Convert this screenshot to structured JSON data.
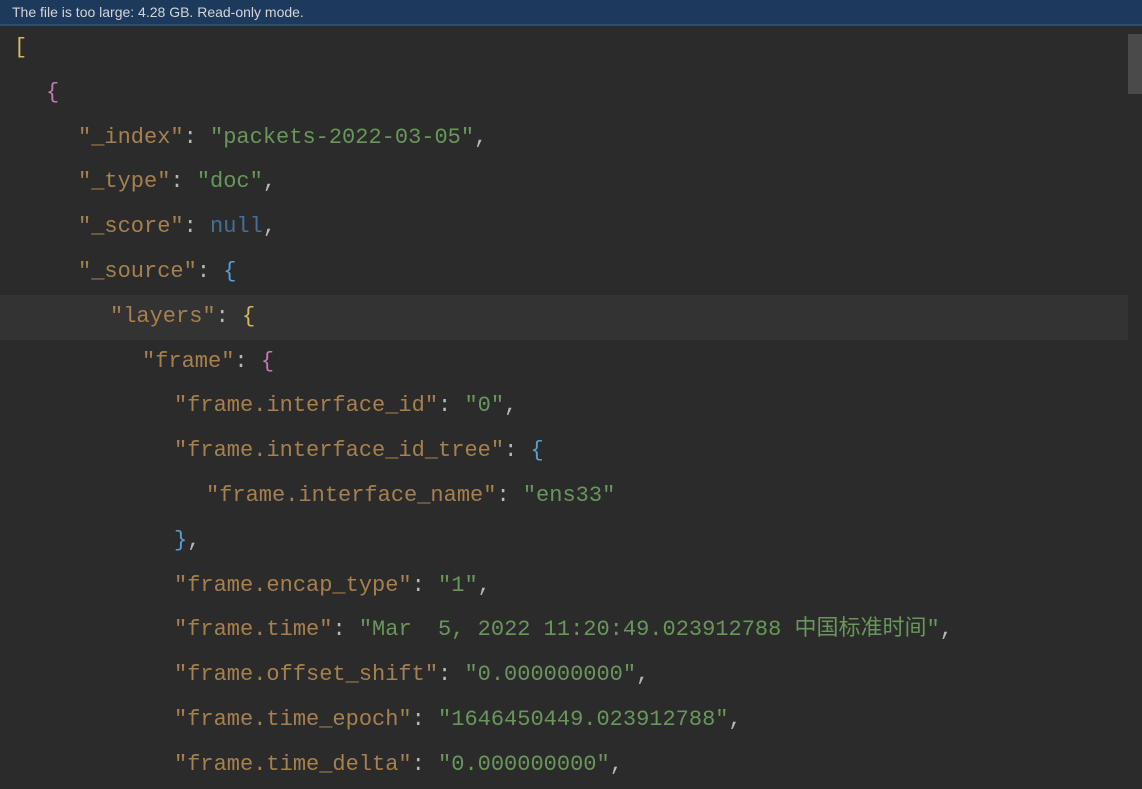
{
  "notification": "The file is too large: 4.28 GB. Read-only mode.",
  "code": {
    "l1": "[",
    "l2_open": "{",
    "l3_key": "\"_index\"",
    "l3_val": "\"packets-2022-03-05\"",
    "l4_key": "\"_type\"",
    "l4_val": "\"doc\"",
    "l5_key": "\"_score\"",
    "l5_val": "null",
    "l6_key": "\"_source\"",
    "l6_open": "{",
    "l7_key": "\"layers\"",
    "l7_open": "{",
    "l8_key": "\"frame\"",
    "l8_open": "{",
    "l9_key": "\"frame.interface_id\"",
    "l9_val": "\"0\"",
    "l10_key": "\"frame.interface_id_tree\"",
    "l10_open": "{",
    "l11_key": "\"frame.interface_name\"",
    "l11_val": "\"ens33\"",
    "l12_close": "}",
    "l13_key": "\"frame.encap_type\"",
    "l13_val": "\"1\"",
    "l14_key": "\"frame.time\"",
    "l14_val": "\"Mar  5, 2022 11:20:49.023912788 中国标准时间\"",
    "l15_key": "\"frame.offset_shift\"",
    "l15_val": "\"0.000000000\"",
    "l16_key": "\"frame.time_epoch\"",
    "l16_val": "\"1646450449.023912788\"",
    "l17_key": "\"frame.time_delta\"",
    "l17_val": "\"0.000000000\""
  }
}
